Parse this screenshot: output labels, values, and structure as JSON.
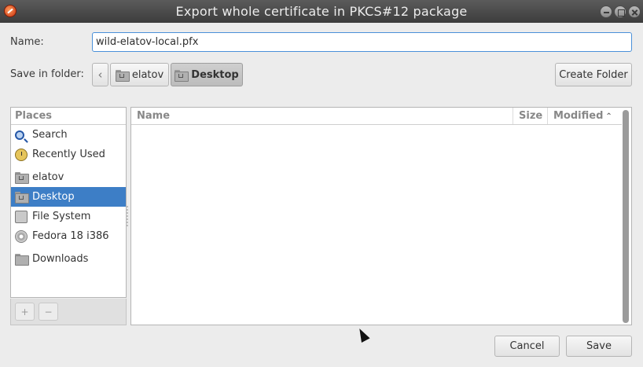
{
  "window": {
    "title": "Export whole certificate in PKCS#12 package"
  },
  "name_row": {
    "label": "Name:",
    "value": "wild-elatov-local.pfx"
  },
  "folder_row": {
    "label": "Save in folder:",
    "back_glyph": "‹",
    "path": [
      "elatov",
      "Desktop"
    ],
    "active": "Desktop",
    "create_folder_label": "Create Folder"
  },
  "places": {
    "header": "Places",
    "items": [
      {
        "label": "Search",
        "icon": "search-icon"
      },
      {
        "label": "Recently Used",
        "icon": "recent-icon"
      },
      {
        "label": "elatov",
        "icon": "home-folder-icon"
      },
      {
        "label": "Desktop",
        "icon": "desktop-folder-icon",
        "selected": true
      },
      {
        "label": "File System",
        "icon": "drive-icon"
      },
      {
        "label": "Fedora 18 i386",
        "icon": "disc-icon"
      },
      {
        "label": "Downloads",
        "icon": "folder-icon"
      }
    ],
    "add_glyph": "+",
    "remove_glyph": "−"
  },
  "files": {
    "columns": [
      "Name",
      "Size",
      "Modified"
    ],
    "sort_column": "Modified",
    "sort_glyph": "⌃",
    "rows": []
  },
  "buttons": {
    "cancel": "Cancel",
    "save": "Save"
  }
}
